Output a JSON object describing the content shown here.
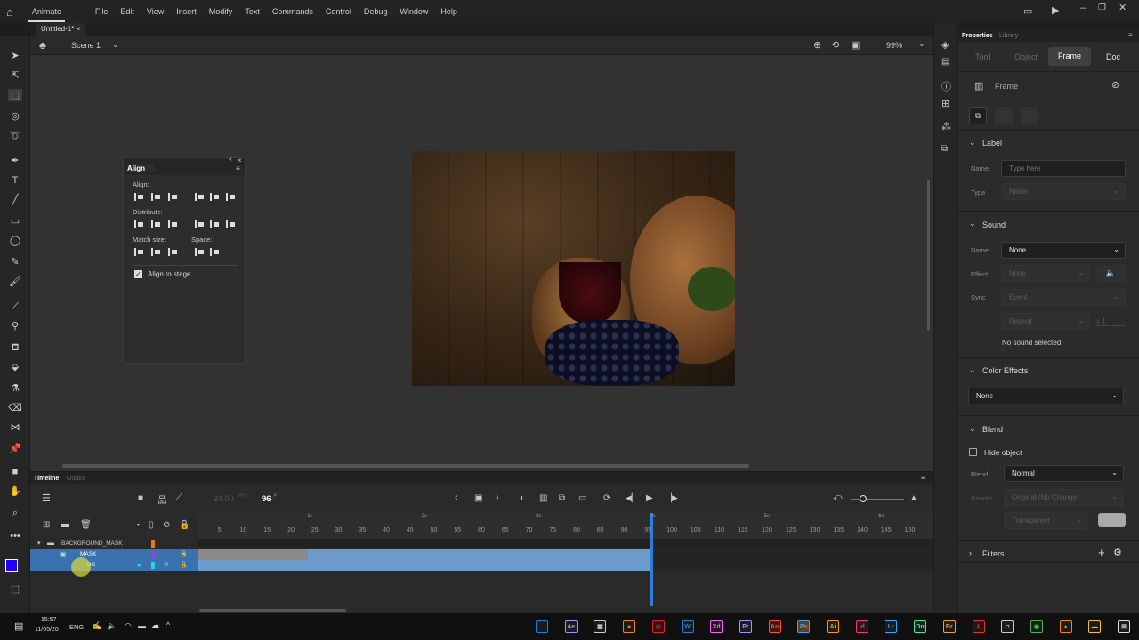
{
  "menubar": {
    "app": "Animate",
    "items": [
      "File",
      "Edit",
      "View",
      "Insert",
      "Modify",
      "Text",
      "Commands",
      "Control",
      "Debug",
      "Window",
      "Help"
    ]
  },
  "document": {
    "tab": "Untitled-1*",
    "scene": "Scene 1",
    "zoom": "99%"
  },
  "align_panel": {
    "title": "Align",
    "align": "Align:",
    "distribute": "Distribute:",
    "match_size": "Match size:",
    "space": "Space:",
    "align_to_stage": "Align to stage",
    "align_to_stage_checked": true
  },
  "properties": {
    "tabs": [
      "Properties",
      "Library"
    ],
    "subtabs": [
      "Tool",
      "Object",
      "Frame",
      "Doc"
    ],
    "active_subtab": "Frame",
    "frame_header": "Frame",
    "label": {
      "title": "Label",
      "name_label": "Name",
      "name_placeholder": "Type here",
      "type_label": "Type",
      "type_value": "Name"
    },
    "sound": {
      "title": "Sound",
      "name_label": "Name",
      "name_value": "None",
      "effect_label": "Effect",
      "effect_value": "None",
      "sync_label": "Sync",
      "sync_value": "Event",
      "repeat_value": "Repeat",
      "repeat_count": "x 1",
      "status": "No sound selected"
    },
    "color_effects": {
      "title": "Color Effects",
      "value": "None"
    },
    "blend": {
      "title": "Blend",
      "hide_object": "Hide object",
      "blend_label": "Blend",
      "blend_value": "Normal",
      "render_label": "Render",
      "render_value": "Original (No Change)",
      "transparent_value": "Transparent"
    },
    "filters": {
      "title": "Filters"
    }
  },
  "timeline": {
    "tabs": [
      "Timeline",
      "Output"
    ],
    "fps": "24.00",
    "fps_unit": "FPS",
    "frame": "96",
    "frame_unit": "F",
    "ruler": [
      "5",
      "10",
      "15",
      "20",
      "25",
      "30",
      "35",
      "40",
      "45",
      "50",
      "55",
      "60",
      "65",
      "70",
      "75",
      "80",
      "85",
      "90",
      "95",
      "100",
      "105",
      "110",
      "115",
      "120",
      "125",
      "130",
      "135",
      "140",
      "145",
      "150"
    ],
    "seconds": [
      "1s",
      "2s",
      "3s",
      "4s",
      "5s",
      "6s"
    ],
    "layers": [
      {
        "name": "BACKGROUND_MASK",
        "color": "#e8751a"
      },
      {
        "name": "MASK",
        "color": "#9b3fd6"
      },
      {
        "name": "BG",
        "color": "#27d3e8"
      }
    ],
    "current_frame": 96
  },
  "taskbar": {
    "time": "15:57",
    "date": "11/05/20",
    "lang": "ENG",
    "apps": [
      {
        "t": "",
        "c": "#1a7fd6"
      },
      {
        "t": "Ae",
        "c": "#9999ff"
      },
      {
        "t": "▦",
        "c": "#ccc"
      },
      {
        "t": "●",
        "c": "#f08020"
      },
      {
        "t": "◎",
        "c": "#e02020"
      },
      {
        "t": "W",
        "c": "#2b7cd3"
      },
      {
        "t": "Xd",
        "c": "#ff61f6"
      },
      {
        "t": "Pr",
        "c": "#9999ff"
      },
      {
        "t": "An",
        "c": "#ff4a3d"
      },
      {
        "t": "Ps",
        "c": "#31a8ff"
      },
      {
        "t": "Ai",
        "c": "#ff9a00"
      },
      {
        "t": "Id",
        "c": "#ff3366"
      },
      {
        "t": "Lr",
        "c": "#31a8ff"
      },
      {
        "t": "Dn",
        "c": "#4de8a0"
      },
      {
        "t": "Br",
        "c": "#e8a33d"
      },
      {
        "t": "⅄",
        "c": "#e03030"
      },
      {
        "t": "◘",
        "c": "#ccc"
      },
      {
        "t": "◉",
        "c": "#4caf50"
      },
      {
        "t": "▲",
        "c": "#f08a00"
      },
      {
        "t": "▬",
        "c": "#f0c040"
      },
      {
        "t": "⊞",
        "c": "#ddd"
      }
    ]
  }
}
